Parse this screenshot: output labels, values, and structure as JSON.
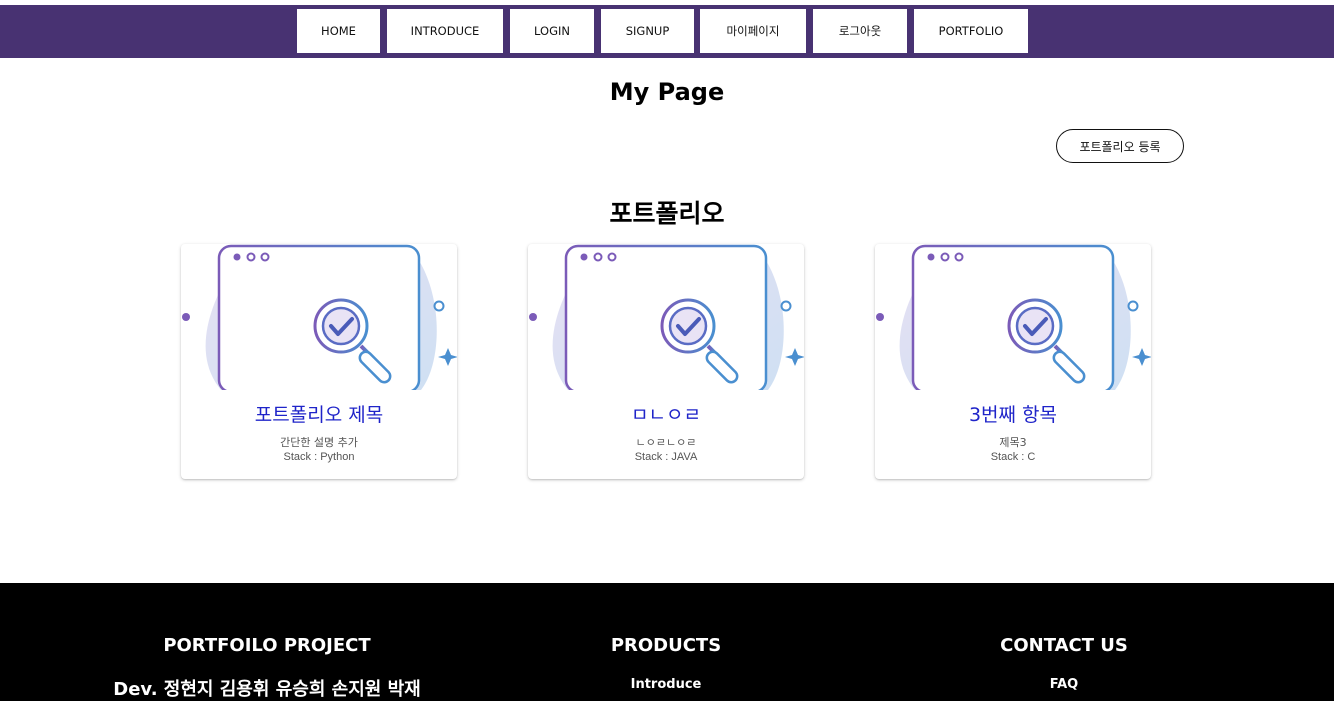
{
  "nav": {
    "items": [
      "HOME",
      "INTRODUCE",
      "LOGIN",
      "SIGNUP",
      "마이페이지",
      "로그아웃",
      "PORTFOLIO"
    ]
  },
  "page": {
    "title": "My Page",
    "register_button": "포트폴리오 등록",
    "section_title": "포트폴리오"
  },
  "cards": [
    {
      "title": "포트폴리오 제목",
      "desc": "간단한 설명 추가",
      "stack": "Stack : Python"
    },
    {
      "title": "ㅁㄴㅇㄹ",
      "desc": "ㄴㅇㄹㄴㅇㄹ",
      "stack": "Stack : JAVA"
    },
    {
      "title": "3번째 항목",
      "desc": "제목3",
      "stack": "Stack : C"
    }
  ],
  "footer": {
    "project": {
      "heading": "PORTFOILO PROJECT",
      "devs": "Dev. 정현지 김용휘 유승희 손지원 박재"
    },
    "products": {
      "heading": "PRODUCTS",
      "link": "Introduce"
    },
    "contact": {
      "heading": "CONTACT US",
      "link": "FAQ"
    }
  },
  "colors": {
    "navbar": "#483272",
    "card_title": "#1f24c9",
    "illustration_purple": "#7b5bb8",
    "illustration_blue": "#4a8fd0",
    "footer": "#000000"
  }
}
